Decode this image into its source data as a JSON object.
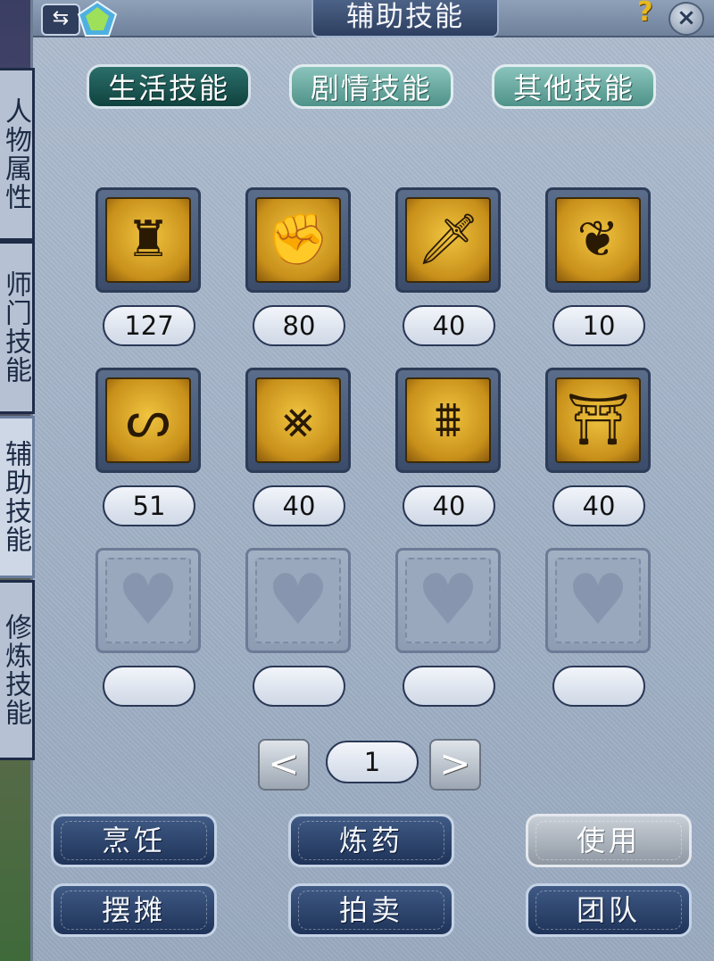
{
  "window": {
    "title": "辅助技能",
    "help_icon": "?",
    "close_icon": "×",
    "back_icon": "⇆"
  },
  "side_tabs": [
    {
      "label": "人物属性",
      "active": false
    },
    {
      "label": "师门技能",
      "active": false
    },
    {
      "label": "辅助技能",
      "active": true
    },
    {
      "label": "修炼技能",
      "active": false
    }
  ],
  "category_tabs": [
    {
      "label": "生活技能",
      "active": true
    },
    {
      "label": "剧情技能",
      "active": false
    },
    {
      "label": "其他技能",
      "active": false
    }
  ],
  "skills": [
    {
      "icon": "crown-fist-icon",
      "glyph": "♜",
      "level": "127"
    },
    {
      "icon": "fist-icon",
      "glyph": "✊",
      "level": "80"
    },
    {
      "icon": "dagger-icon",
      "glyph": "🗡",
      "level": "40"
    },
    {
      "icon": "sprout-icon",
      "glyph": "❦",
      "level": "10"
    },
    {
      "icon": "spiral-icon",
      "glyph": "ᔕ",
      "level": "51"
    },
    {
      "icon": "weave-icon",
      "glyph": "⨳",
      "level": "40"
    },
    {
      "icon": "gate-icon",
      "glyph": "⩩",
      "level": "40"
    },
    {
      "icon": "pavilion-icon",
      "glyph": "⛩",
      "level": "40"
    },
    {
      "icon": "heart-icon",
      "glyph": "♥",
      "level": ""
    },
    {
      "icon": "heart-icon",
      "glyph": "♥",
      "level": ""
    },
    {
      "icon": "heart-icon",
      "glyph": "♥",
      "level": ""
    },
    {
      "icon": "heart-icon",
      "glyph": "♥",
      "level": ""
    }
  ],
  "pager": {
    "prev": "<",
    "next": ">",
    "page": "1"
  },
  "buttons": {
    "cook": "烹饪",
    "alchemy": "炼药",
    "use": "使用",
    "stall": "摆摊",
    "auction": "拍卖",
    "team": "团队"
  }
}
